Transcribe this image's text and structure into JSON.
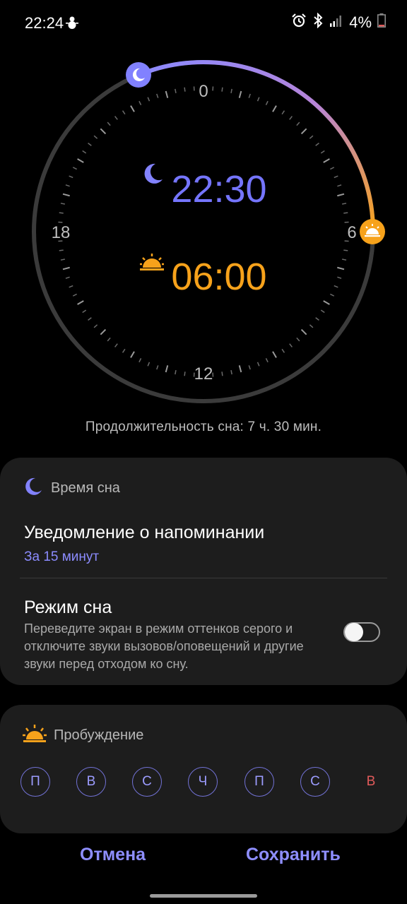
{
  "status_bar": {
    "time": "22:24",
    "battery": "4%"
  },
  "dial": {
    "labels": {
      "top": "0",
      "right": "6",
      "bottom": "12",
      "left": "18"
    },
    "bedtime": "22:30",
    "wake_time": "06:00"
  },
  "duration_text": "Продолжительность сна: 7 ч. 30 мин.",
  "bedtime_card": {
    "header": "Время сна",
    "reminder_title": "Уведомление о напоминании",
    "reminder_value": "За 15 минут",
    "sleep_mode_title": "Режим сна",
    "sleep_mode_desc": "Переведите экран в режим оттенков серого и отключите звуки вызовов/оповещений и другие звуки перед отходом ко сну.",
    "sleep_mode_on": false
  },
  "wake_card": {
    "header": "Пробуждение",
    "days": [
      "П",
      "В",
      "С",
      "Ч",
      "П",
      "С",
      "В"
    ]
  },
  "actions": {
    "cancel": "Отмена",
    "save": "Сохранить"
  },
  "colors": {
    "accent": "#8c8cff",
    "bedtime": "#7b7bff",
    "wake": "#f7a21b",
    "sunday": "#e05a5a"
  }
}
